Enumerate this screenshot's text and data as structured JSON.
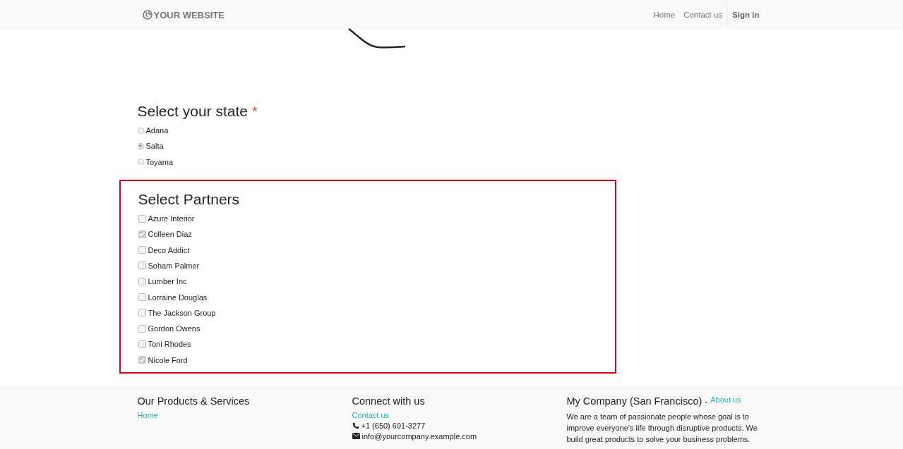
{
  "navbar": {
    "brand": "YOUR WEBSITE",
    "links": [
      {
        "label": "Home",
        "kind": "link"
      },
      {
        "label": "Contact us",
        "kind": "link"
      },
      {
        "label": "Sign in",
        "kind": "signin"
      }
    ]
  },
  "state_question": {
    "title": "Select your state",
    "required_mark": "*",
    "options": [
      {
        "label": "Adana",
        "selected": false,
        "disabled": true
      },
      {
        "label": "Salta",
        "selected": true,
        "disabled": true
      },
      {
        "label": "Toyama",
        "selected": false,
        "disabled": true
      }
    ]
  },
  "partners_question": {
    "title": "Select Partners",
    "highlighted": true,
    "options": [
      {
        "label": "Azure Interior",
        "checked": false,
        "disabled": true
      },
      {
        "label": "Colleen Diaz",
        "checked": true,
        "disabled": true
      },
      {
        "label": "Deco Addict",
        "checked": false,
        "disabled": true
      },
      {
        "label": "Soham Palmer",
        "checked": false,
        "disabled": true
      },
      {
        "label": "Lumber Inc",
        "checked": false,
        "disabled": true
      },
      {
        "label": "Lorraine Douglas",
        "checked": false,
        "disabled": true
      },
      {
        "label": "The Jackson Group",
        "checked": false,
        "disabled": true
      },
      {
        "label": "Gordon Owens",
        "checked": false,
        "disabled": true
      },
      {
        "label": "Toni Rhodes",
        "checked": false,
        "disabled": true
      },
      {
        "label": "Nicole Ford",
        "checked": true,
        "disabled": true
      }
    ]
  },
  "footer": {
    "products": {
      "title": "Our Products & Services",
      "links": [
        "Home"
      ]
    },
    "connect": {
      "title": "Connect with us",
      "link": "Contact us",
      "phone": "+1 (650) 691-3277",
      "email": "info@yourcompany.example.com"
    },
    "company": {
      "title": "My Company (San Francisco)",
      "separator": "-",
      "link": "About us",
      "text": "We are a team of passionate people whose goal is to improve everyone's life through disruptive products. We build great products to solve your business problems."
    }
  }
}
